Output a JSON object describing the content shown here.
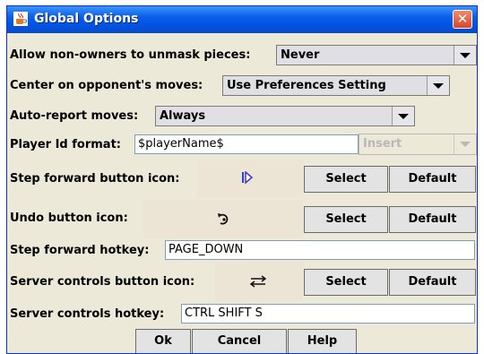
{
  "window": {
    "title": "Global Options"
  },
  "options": {
    "unmask": {
      "label": "Allow non-owners to unmask pieces:",
      "value": "Never"
    },
    "center": {
      "label": "Center on opponent's moves:",
      "value": "Use Preferences Setting"
    },
    "auto_report": {
      "label": "Auto-report moves:",
      "value": "Always"
    },
    "player_id": {
      "label": "Player Id format:",
      "value": "$playerName$",
      "insert_label": "Insert"
    },
    "step_forward_icon": {
      "label": "Step forward button icon:",
      "select_label": "Select",
      "default_label": "Default"
    },
    "undo_icon": {
      "label": "Undo button icon:",
      "select_label": "Select",
      "default_label": "Default"
    },
    "step_forward_hotkey": {
      "label": "Step forward hotkey:",
      "value": "PAGE_DOWN"
    },
    "server_controls_icon": {
      "label": "Server controls button icon:",
      "select_label": "Select",
      "default_label": "Default"
    },
    "server_controls_hotkey": {
      "label": "Server controls hotkey:",
      "value": "CTRL SHIFT S"
    }
  },
  "footer": {
    "ok_label": "Ok",
    "cancel_label": "Cancel",
    "help_label": "Help"
  },
  "colors": {
    "titlebar": "#0054e3",
    "panel": "#ece9d8",
    "icon_bg": "#ece4d4",
    "close": "#d8462a",
    "icon_stroke": "#3a3ad8"
  }
}
